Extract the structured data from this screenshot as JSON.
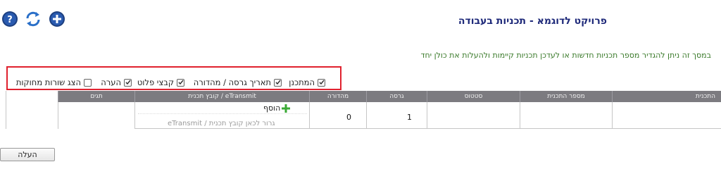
{
  "header": {
    "title": "פרויקט לדוגמא - תכניות בעבודה",
    "icons": [
      "help-icon",
      "refresh-icon",
      "add-icon"
    ],
    "colors": {
      "title": "#1f2a7a",
      "description": "#3a7a2a",
      "highlight_border": "#e0212e",
      "table_header": "#7c7b80",
      "add_icon": "#3aa935"
    }
  },
  "description": "במסך זה ניתן להגדיר מספר תכניות חדשות או לעדכן תכניות קיימות ולהעלות את כולן יחד",
  "options": [
    {
      "label": "המתכנן",
      "checked": true
    },
    {
      "label": "תאריך גרסה / מהדורה",
      "checked": true
    },
    {
      "label": "קבצי פלוט",
      "checked": true
    },
    {
      "label": "הערה",
      "checked": true
    },
    {
      "label": "הצג שורות מחוקות",
      "checked": false
    }
  ],
  "table": {
    "columns": {
      "plan_name": "התכנית",
      "plan_number": "מספר התכנית",
      "status": "סטטוס",
      "version": "גרסה",
      "edition": "מהדורה",
      "file": "קובץ תכנית / eTransmit",
      "tags": "תגים"
    },
    "row": {
      "version": "1",
      "edition": "0",
      "add_label": "הוסף",
      "drop_hint": "גרור לכאן קובץ תכנית / eTransmit"
    }
  },
  "upload_button": "העלה"
}
